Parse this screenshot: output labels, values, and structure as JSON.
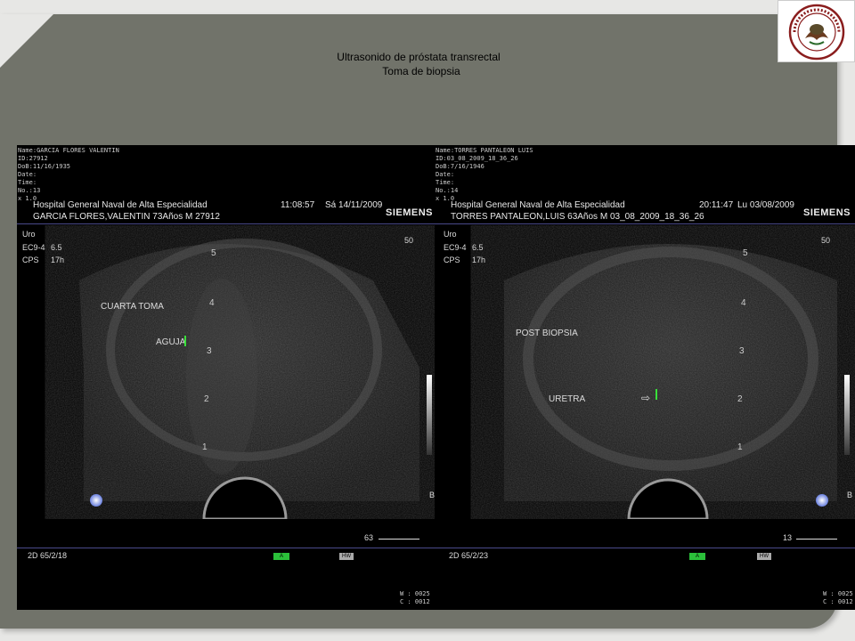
{
  "slide": {
    "title_line1": "Ultrasonido de próstata transrectal",
    "title_line2": "Toma de biopsia",
    "logo_text": "SECRETARIA DE MARINA ARMADA DE MEXICO"
  },
  "panels": [
    {
      "side": "left",
      "patient_meta": "Name:GARCIA FLORES VALENTIN\nID:27912\nDoB:11/16/1935\nDate:\nTime:\nNo.:13\nx 1.0",
      "hospital": "Hospital General Naval de Alta Especialidad",
      "patient_line": "GARCIA FLORES,VALENTIN 73Años M 27912",
      "time": "11:08:57",
      "date": "Sá 14/11/2009",
      "brand": "SIEMENS",
      "mode": "Uro",
      "probe": "EC9-4",
      "probe_val": "6.5",
      "cps": "CPS",
      "cps_val": "17h",
      "depth": "50",
      "annotation1": "CUARTA TOMA",
      "annotation2": "AGUJA",
      "scale_ticks": [
        "5",
        "4",
        "3",
        "2",
        "1"
      ],
      "frame_count": "63",
      "footer_left": "2D 65/2/18",
      "footer_green": "A",
      "footer_gray": "HW",
      "wc": "W : 0025\nC : 0012",
      "b_marker": "B"
    },
    {
      "side": "right",
      "patient_meta": "Name:TORRES PANTALEON LUIS\nID:03_08_2009_18_36_26\nDoB:7/16/1946\nDate:\nTime:\nNo.:14\nx 1.0",
      "hospital": "Hospital General Naval de Alta Especialidad",
      "patient_line": "TORRES PANTALEON,LUIS 63Años M 03_08_2009_18_36_26",
      "time": "20:11:47",
      "date": "Lu 03/08/2009",
      "brand": "SIEMENS",
      "mode": "Uro",
      "probe": "EC9-4",
      "probe_val": "6.5",
      "cps": "CPS",
      "cps_val": "17h",
      "depth": "50",
      "annotation1": "POST BIOPSIA",
      "annotation2": "URETRA",
      "scale_ticks": [
        "5",
        "4",
        "3",
        "2",
        "1"
      ],
      "frame_count": "13",
      "footer_left": "2D 65/2/23",
      "footer_green": "A",
      "footer_gray": "HW",
      "wc": "W : 0025\nC : 0012",
      "b_marker": "B"
    }
  ]
}
